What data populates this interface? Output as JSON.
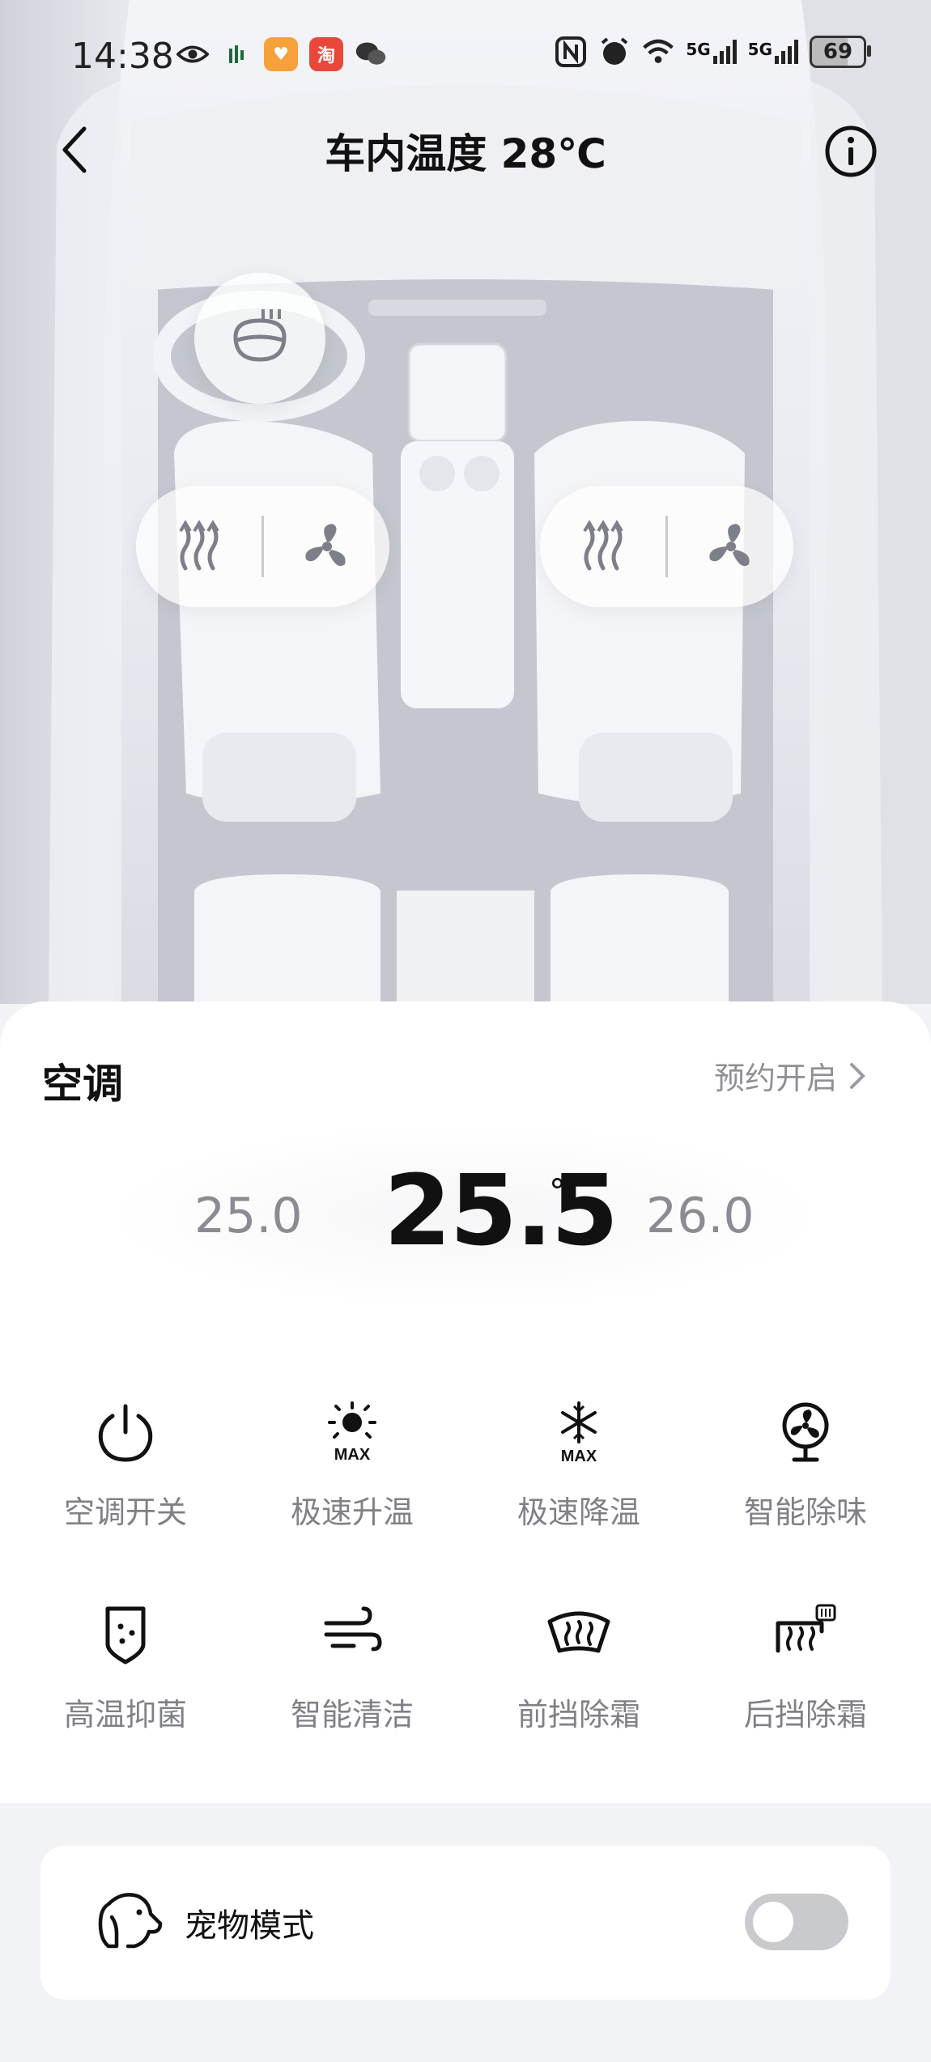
{
  "status_bar": {
    "time": "14:38",
    "battery": "69",
    "network_1": "5G",
    "network_2": "5G"
  },
  "nav": {
    "title": "车内温度 28℃",
    "back_icon": "chevron-left-icon",
    "info_icon": "info-icon"
  },
  "hero": {
    "steering_wheel_heat_icon": "steering-wheel-heat-icon",
    "driver_seat": {
      "heat_icon": "seat-heat-icon",
      "vent_icon": "seat-fan-icon"
    },
    "passenger_seat": {
      "heat_icon": "seat-heat-icon",
      "vent_icon": "seat-fan-icon"
    }
  },
  "ac": {
    "title": "空调",
    "schedule_label": "预约开启",
    "temp_prev": "25.0",
    "temp_current": "25.5",
    "temp_unit": "℃",
    "temp_next": "26.0"
  },
  "functions": [
    {
      "label": "空调开关",
      "icon": "power-icon"
    },
    {
      "label": "极速升温",
      "icon": "sun-max-icon"
    },
    {
      "label": "极速降温",
      "icon": "snowflake-max-icon"
    },
    {
      "label": "智能除味",
      "icon": "fan-icon"
    },
    {
      "label": "高温抑菌",
      "icon": "shield-dots-icon"
    },
    {
      "label": "智能清洁",
      "icon": "wind-icon"
    },
    {
      "label": "前挡除霜",
      "icon": "front-defrost-icon"
    },
    {
      "label": "后挡除霜",
      "icon": "rear-defrost-icon"
    }
  ],
  "pet_mode": {
    "label": "宠物模式",
    "icon": "dog-icon",
    "enabled": false
  },
  "colors": {
    "accent_text": "#111111",
    "muted_text": "#8e9096",
    "toggle_off": "#c9cacd"
  }
}
